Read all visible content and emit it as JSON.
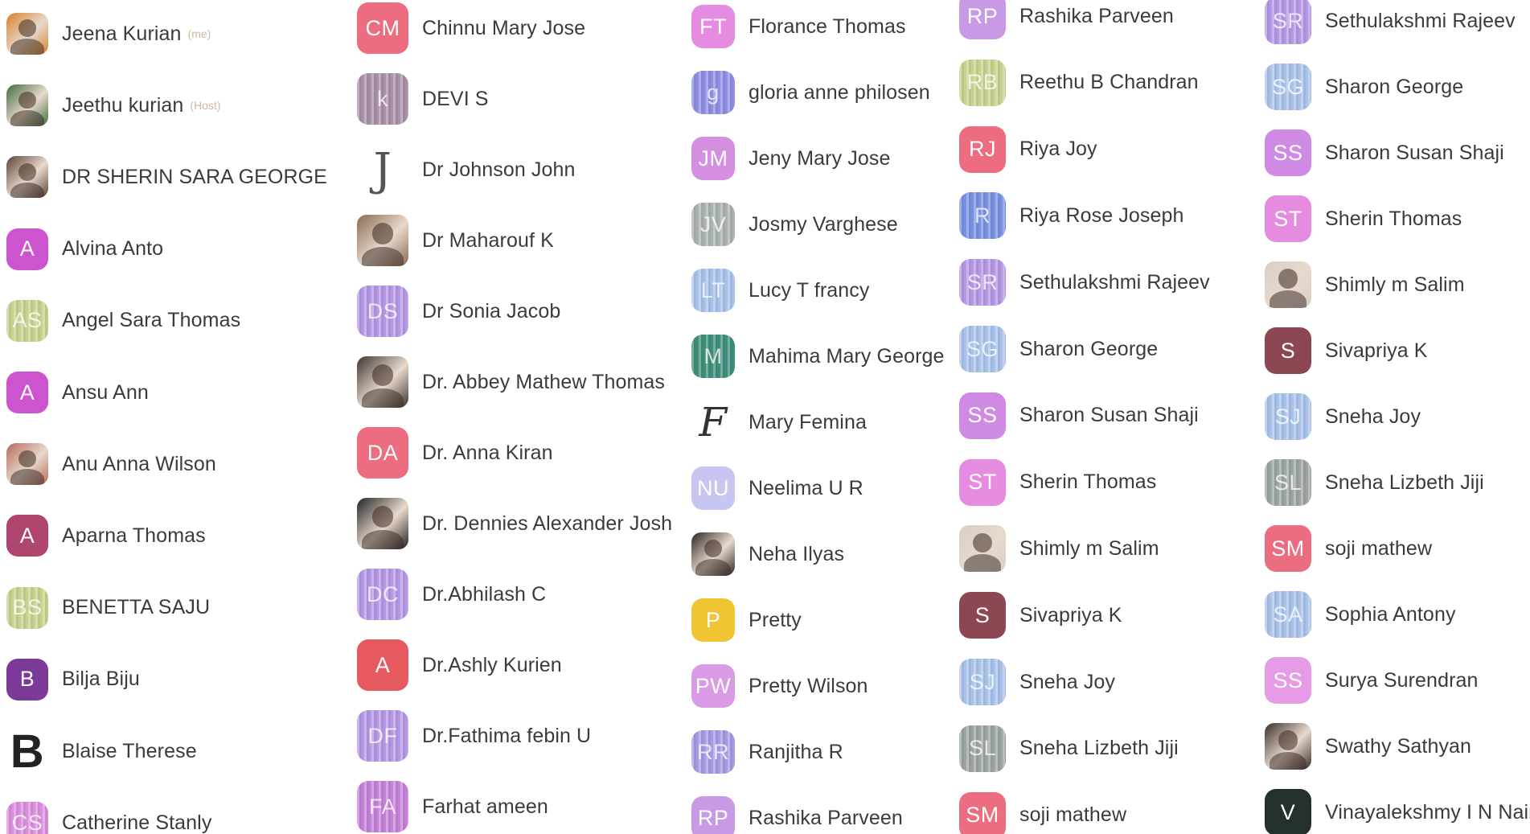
{
  "colors": {
    "name_text": "#3b3b3b",
    "tag_text": "#ccbaa0",
    "background": "#ffffff"
  },
  "columns": [
    {
      "id": "col1",
      "members": [
        {
          "name": "Jeena Kurian",
          "tag": "(me)",
          "initials": "",
          "avatar_type": "photo",
          "color": "#d9812b",
          "icon": "photo-avatar-icon"
        },
        {
          "name": "Jeethu kurian",
          "tag": "(Host)",
          "initials": "",
          "avatar_type": "photo",
          "color": "#3f6b3b",
          "icon": "photo-avatar-icon"
        },
        {
          "name": "DR SHERIN SARA GEORGE",
          "tag": "",
          "initials": "",
          "avatar_type": "photo",
          "color": "#5b4236",
          "icon": "photo-avatar-icon"
        },
        {
          "name": "Alvina Anto",
          "tag": "",
          "initials": "A",
          "avatar_type": "letter",
          "color": "#cc55cf"
        },
        {
          "name": "Angel Sara Thomas",
          "tag": "",
          "initials": "AS",
          "avatar_type": "stripe",
          "color": "#c8d28e"
        },
        {
          "name": "Ansu Ann",
          "tag": "",
          "initials": "A",
          "avatar_type": "letter",
          "color": "#cc55cf"
        },
        {
          "name": "Anu Anna Wilson",
          "tag": "",
          "initials": "",
          "avatar_type": "photo",
          "color": "#b76a57",
          "icon": "photo-avatar-icon"
        },
        {
          "name": "Aparna Thomas",
          "tag": "",
          "initials": "A",
          "avatar_type": "letter",
          "color": "#b0456f"
        },
        {
          "name": "BENETTA SAJU",
          "tag": "",
          "initials": "BS",
          "avatar_type": "stripe",
          "color": "#c8d28e"
        },
        {
          "name": "Bilja Biju",
          "tag": "",
          "initials": "B",
          "avatar_type": "letter",
          "color": "#7b3a97"
        },
        {
          "name": "Blaise Therese",
          "tag": "",
          "initials": "B",
          "avatar_type": "bigletter",
          "color": "#222222"
        },
        {
          "name": "Catherine Stanly",
          "tag": "",
          "initials": "CS",
          "avatar_type": "stripe",
          "color": "#dc8ede"
        }
      ]
    },
    {
      "id": "col2",
      "members": [
        {
          "name": "Chinnu Mary Jose",
          "tag": "",
          "initials": "CM",
          "avatar_type": "letter",
          "color": "#ec6c80"
        },
        {
          "name": "DEVI S",
          "tag": "",
          "initials": "k",
          "avatar_type": "stripe",
          "color": "#a991a8"
        },
        {
          "name": "Dr Johnson John",
          "tag": "",
          "initials": "J",
          "avatar_type": "outline-j",
          "color": "#555555"
        },
        {
          "name": "Dr Maharouf K",
          "tag": "",
          "initials": "",
          "avatar_type": "photo",
          "color": "#8a6a52",
          "icon": "photo-avatar-icon"
        },
        {
          "name": "Dr Sonia Jacob",
          "tag": "",
          "initials": "DS",
          "avatar_type": "stripe",
          "color": "#b597e4"
        },
        {
          "name": "Dr. Abbey Mathew Thomas",
          "tag": "",
          "initials": "",
          "avatar_type": "photo",
          "color": "#3d3531",
          "icon": "photo-avatar-icon"
        },
        {
          "name": "Dr. Anna Kiran",
          "tag": "",
          "initials": "DA",
          "avatar_type": "letter",
          "color": "#ec6c80"
        },
        {
          "name": "Dr. Dennies Alexander Josh",
          "tag": "",
          "initials": "",
          "avatar_type": "photo",
          "color": "#222222",
          "icon": "photo-avatar-icon"
        },
        {
          "name": "Dr.Abhilash C",
          "tag": "",
          "initials": "DC",
          "avatar_type": "stripe",
          "color": "#b597e4"
        },
        {
          "name": "Dr.Ashly Kurien",
          "tag": "",
          "initials": "A",
          "avatar_type": "letter",
          "color": "#e65a5f"
        },
        {
          "name": "Dr.Fathima febin U",
          "tag": "",
          "initials": "DF",
          "avatar_type": "stripe",
          "color": "#b597e4"
        },
        {
          "name": "Farhat ameen",
          "tag": "",
          "initials": "FA",
          "avatar_type": "stripe",
          "color": "#c581d8"
        }
      ]
    },
    {
      "id": "col3",
      "members": [
        {
          "name": "Florance Thomas",
          "tag": "",
          "initials": "FT",
          "avatar_type": "letter",
          "color": "#e58ce0"
        },
        {
          "name": "gloria anne philosen",
          "tag": "",
          "initials": "g",
          "avatar_type": "stripe",
          "color": "#8f8ee3"
        },
        {
          "name": "Jeny Mary Jose",
          "tag": "",
          "initials": "JM",
          "avatar_type": "letter",
          "color": "#d48fe0"
        },
        {
          "name": "Josmy Varghese",
          "tag": "",
          "initials": "JV",
          "avatar_type": "stripe",
          "color": "#a9b1b1"
        },
        {
          "name": "Lucy T francy",
          "tag": "",
          "initials": "LT",
          "avatar_type": "stripe",
          "color": "#a9c2ea"
        },
        {
          "name": "Mahima Mary George",
          "tag": "",
          "initials": "M",
          "avatar_type": "stripe",
          "color": "#3f8e7b"
        },
        {
          "name": "Mary Femina",
          "tag": "",
          "initials": "F",
          "avatar_type": "script",
          "color": "#333333"
        },
        {
          "name": "Neelima U R",
          "tag": "",
          "initials": "NU",
          "avatar_type": "letter",
          "color": "#c7c5f2"
        },
        {
          "name": "Neha Ilyas",
          "tag": "",
          "initials": "",
          "avatar_type": "photo",
          "color": "#2b2624",
          "icon": "photo-avatar-icon"
        },
        {
          "name": "Pretty",
          "tag": "",
          "initials": "P",
          "avatar_type": "letter",
          "color": "#f1c434"
        },
        {
          "name": "Pretty Wilson",
          "tag": "",
          "initials": "PW",
          "avatar_type": "letter",
          "color": "#d99be6"
        },
        {
          "name": "Ranjitha R",
          "tag": "",
          "initials": "RR",
          "avatar_type": "stripe",
          "color": "#a59ae3"
        },
        {
          "name": "Rashika Parveen",
          "tag": "",
          "initials": "RP",
          "avatar_type": "letter",
          "color": "#c89ae6"
        }
      ]
    },
    {
      "id": "col4",
      "members": [
        {
          "name": "Rashika Parveen",
          "tag": "",
          "initials": "RP",
          "avatar_type": "letter",
          "color": "#c89ae6"
        },
        {
          "name": "Reethu B Chandran",
          "tag": "",
          "initials": "RB",
          "avatar_type": "stripe",
          "color": "#c8d28e"
        },
        {
          "name": "Riya Joy",
          "tag": "",
          "initials": "RJ",
          "avatar_type": "letter",
          "color": "#ec6c80"
        },
        {
          "name": "Riya Rose Joseph",
          "tag": "",
          "initials": "R",
          "avatar_type": "stripe",
          "color": "#7891e1"
        },
        {
          "name": "Sethulakshmi Rajeev",
          "tag": "",
          "initials": "SR",
          "avatar_type": "stripe",
          "color": "#b597e4"
        },
        {
          "name": "Sharon George",
          "tag": "",
          "initials": "SG",
          "avatar_type": "stripe",
          "color": "#a9c2ea"
        },
        {
          "name": "Sharon Susan Shaji",
          "tag": "",
          "initials": "SS",
          "avatar_type": "letter",
          "color": "#cf8ae3"
        },
        {
          "name": "Sherin Thomas",
          "tag": "",
          "initials": "ST",
          "avatar_type": "letter",
          "color": "#e58ce0"
        },
        {
          "name": "Shimly m Salim",
          "tag": "",
          "initials": "",
          "avatar_type": "photo",
          "color": "#d7cfc9",
          "icon": "photo-avatar-icon"
        },
        {
          "name": "Sivapriya K",
          "tag": "",
          "initials": "S",
          "avatar_type": "letter",
          "color": "#8c4752"
        },
        {
          "name": "Sneha Joy",
          "tag": "",
          "initials": "SJ",
          "avatar_type": "stripe",
          "color": "#a9c2ea"
        },
        {
          "name": "Sneha Lizbeth Jiji",
          "tag": "",
          "initials": "SL",
          "avatar_type": "stripe",
          "color": "#9ca4a4"
        },
        {
          "name": "soji mathew",
          "tag": "",
          "initials": "SM",
          "avatar_type": "letter",
          "color": "#ec6c80"
        }
      ]
    },
    {
      "id": "col5",
      "members": [
        {
          "name": "Sethulakshmi Rajeev",
          "tag": "",
          "initials": "SR",
          "avatar_type": "stripe",
          "color": "#b597e4"
        },
        {
          "name": "Sharon George",
          "tag": "",
          "initials": "SG",
          "avatar_type": "stripe",
          "color": "#a9c2ea"
        },
        {
          "name": "Sharon Susan Shaji",
          "tag": "",
          "initials": "SS",
          "avatar_type": "letter",
          "color": "#cf8ae3"
        },
        {
          "name": "Sherin Thomas",
          "tag": "",
          "initials": "ST",
          "avatar_type": "letter",
          "color": "#e58ce0"
        },
        {
          "name": "Shimly m Salim",
          "tag": "",
          "initials": "",
          "avatar_type": "photo",
          "color": "#d7cfc9",
          "icon": "photo-avatar-icon"
        },
        {
          "name": "Sivapriya K",
          "tag": "",
          "initials": "S",
          "avatar_type": "letter",
          "color": "#8c4752"
        },
        {
          "name": "Sneha Joy",
          "tag": "",
          "initials": "SJ",
          "avatar_type": "stripe",
          "color": "#a9c2ea"
        },
        {
          "name": "Sneha Lizbeth Jiji",
          "tag": "",
          "initials": "SL",
          "avatar_type": "stripe",
          "color": "#9ca4a4"
        },
        {
          "name": "soji mathew",
          "tag": "",
          "initials": "SM",
          "avatar_type": "letter",
          "color": "#ec6c80"
        },
        {
          "name": "Sophia Antony",
          "tag": "",
          "initials": "SA",
          "avatar_type": "stripe",
          "color": "#a9c2ea"
        },
        {
          "name": "Surya Surendran",
          "tag": "",
          "initials": "SS",
          "avatar_type": "letter",
          "color": "#e59be6"
        },
        {
          "name": "Swathy Sathyan",
          "tag": "",
          "initials": "",
          "avatar_type": "photo",
          "color": "#3a2e2b",
          "icon": "photo-avatar-icon"
        },
        {
          "name": "Vinayalekshmy I N Nair",
          "tag": "",
          "initials": "V",
          "avatar_type": "letter",
          "color": "#24302a"
        }
      ]
    }
  ]
}
